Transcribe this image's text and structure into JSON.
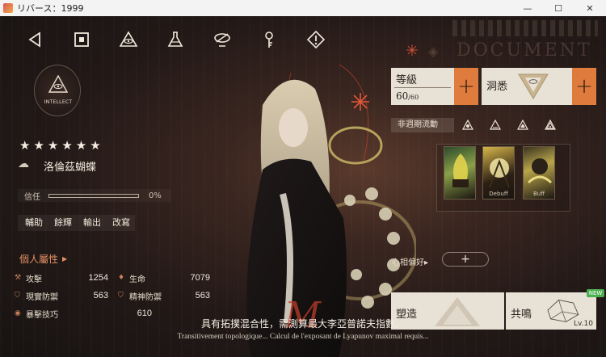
{
  "window": {
    "title": "リバース：1999",
    "minimize": "—",
    "maximize": "☐",
    "close": "✕"
  },
  "topnav": {
    "icons": [
      "back-icon",
      "home-icon",
      "eye-icon",
      "flask-icon",
      "chain-icon",
      "key-icon",
      "warning-icon"
    ]
  },
  "background": {
    "document_text": "DOCUMENT"
  },
  "character": {
    "afflatus_label": "INTELLECT",
    "stars": "★★★★★★",
    "name": "洛倫茲蝴蝶",
    "trust_label": "信任",
    "trust_percent": "0%",
    "trust_fraction": 0,
    "actions": [
      "輔助",
      "餘輝",
      "輸出",
      "改寫"
    ]
  },
  "attributes": {
    "header": "個人屬性",
    "rows": [
      {
        "name": "攻擊",
        "value": "1254",
        "icon": "attack-icon"
      },
      {
        "name": "生命",
        "value": "7079",
        "icon": "health-icon"
      },
      {
        "name": "現實防禦",
        "value": "563",
        "icon": "reality-defense-icon"
      },
      {
        "name": "精神防禦",
        "value": "563",
        "icon": "mental-defense-icon"
      },
      {
        "name": "暴擊技巧",
        "value": "610",
        "icon": "crit-icon"
      }
    ]
  },
  "level": {
    "label": "等級",
    "current": "60",
    "max": "/60"
  },
  "insight": {
    "label": "洞悉"
  },
  "portray": {
    "label": "非週期流動",
    "icons": [
      "portray-1-icon",
      "portray-2-icon",
      "portray-3-icon",
      "portray-4-icon"
    ]
  },
  "skills": {
    "tags": [
      "",
      "Debuff",
      "Buff"
    ]
  },
  "resonance_pref": {
    "label": "心相偏好",
    "arrow": "▸",
    "add": "+"
  },
  "buttons": {
    "forge": "塑造",
    "resonate": "共鳴",
    "resonate_level": "Lv.10",
    "new_badge": "NEW"
  },
  "subtitle": {
    "chinese": "具有拓撲混合性，需測算最大李亞普諾夫指數。",
    "french": "Transitivement topologique... Calcul de l'exposant de Lyapunov maximal requis..."
  },
  "colors": {
    "accent_orange": "#e07b3e",
    "panel_cream": "#e8e1d6",
    "attribute_header": "#e19063"
  }
}
